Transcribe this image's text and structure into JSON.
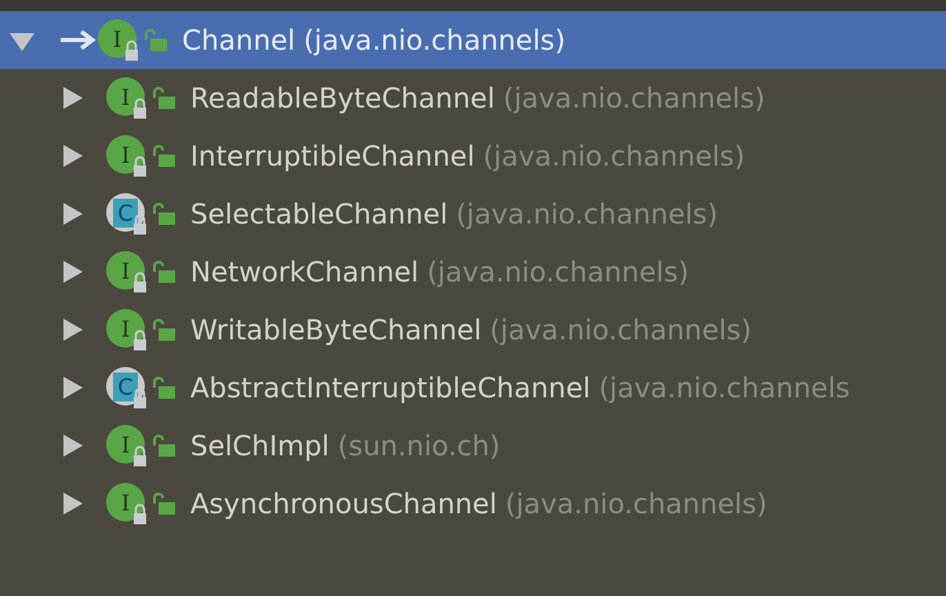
{
  "tree": {
    "root": {
      "name": "Channel",
      "package": "(java.nio.channels)",
      "kind": "interface",
      "icon_letter": "I",
      "expanded": true,
      "selected": true,
      "children": [
        {
          "name": "ReadableByteChannel",
          "package": "(java.nio.channels)",
          "kind": "interface",
          "icon_letter": "I",
          "expanded": false,
          "selected": false
        },
        {
          "name": "InterruptibleChannel",
          "package": "(java.nio.channels)",
          "kind": "interface",
          "icon_letter": "I",
          "expanded": false,
          "selected": false
        },
        {
          "name": "SelectableChannel",
          "package": "(java.nio.channels)",
          "kind": "abstract_class",
          "icon_letter": "C",
          "expanded": false,
          "selected": false
        },
        {
          "name": "NetworkChannel",
          "package": "(java.nio.channels)",
          "kind": "interface",
          "icon_letter": "I",
          "expanded": false,
          "selected": false
        },
        {
          "name": "WritableByteChannel",
          "package": "(java.nio.channels)",
          "kind": "interface",
          "icon_letter": "I",
          "expanded": false,
          "selected": false
        },
        {
          "name": "AbstractInterruptibleChannel",
          "package": "(java.nio.channels",
          "kind": "abstract_class",
          "icon_letter": "C",
          "expanded": false,
          "selected": false
        },
        {
          "name": "SelChImpl",
          "package": "(sun.nio.ch)",
          "kind": "interface",
          "icon_letter": "I",
          "expanded": false,
          "selected": false
        },
        {
          "name": "AsynchronousChannel",
          "package": "(java.nio.channels)",
          "kind": "interface",
          "icon_letter": "I",
          "expanded": false,
          "selected": false
        }
      ]
    }
  }
}
